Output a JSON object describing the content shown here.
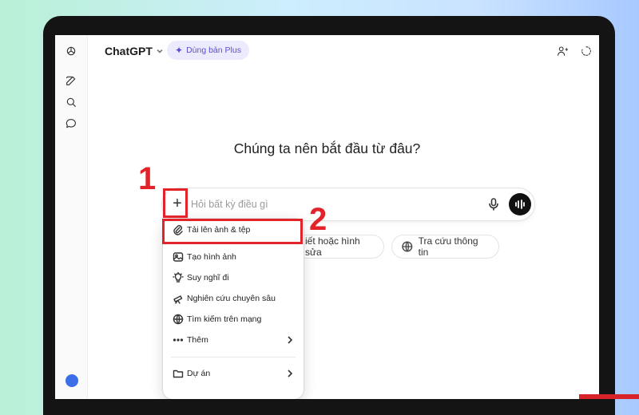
{
  "app": {
    "title": "ChatGPT",
    "upgrade_label": "Dùng bản Plus"
  },
  "main": {
    "heading": "Chúng ta nên bắt đầu từ đâu?",
    "composer": {
      "placeholder": "Hỏi bất kỳ điều gì"
    },
    "chips": [
      {
        "label": "iết hoặc hình sửa"
      },
      {
        "label": "Tra cứu thông tin"
      }
    ]
  },
  "menu": {
    "items": [
      {
        "label": "Tải lên ảnh & tệp",
        "icon": "paperclip-icon"
      },
      {
        "label": "Tạo hình ảnh",
        "icon": "image-icon"
      },
      {
        "label": "Suy nghĩ đi",
        "icon": "lightbulb-icon"
      },
      {
        "label": "Nghiên cứu chuyên sâu",
        "icon": "telescope-icon"
      },
      {
        "label": "Tìm kiếm trên mạng",
        "icon": "globe-icon"
      },
      {
        "label": "Thêm",
        "icon": "more-icon"
      },
      {
        "label": "Dự án",
        "icon": "folder-icon"
      }
    ]
  },
  "annotations": {
    "step1": "1",
    "step2": "2",
    "highlight_color": "#e2232a"
  }
}
